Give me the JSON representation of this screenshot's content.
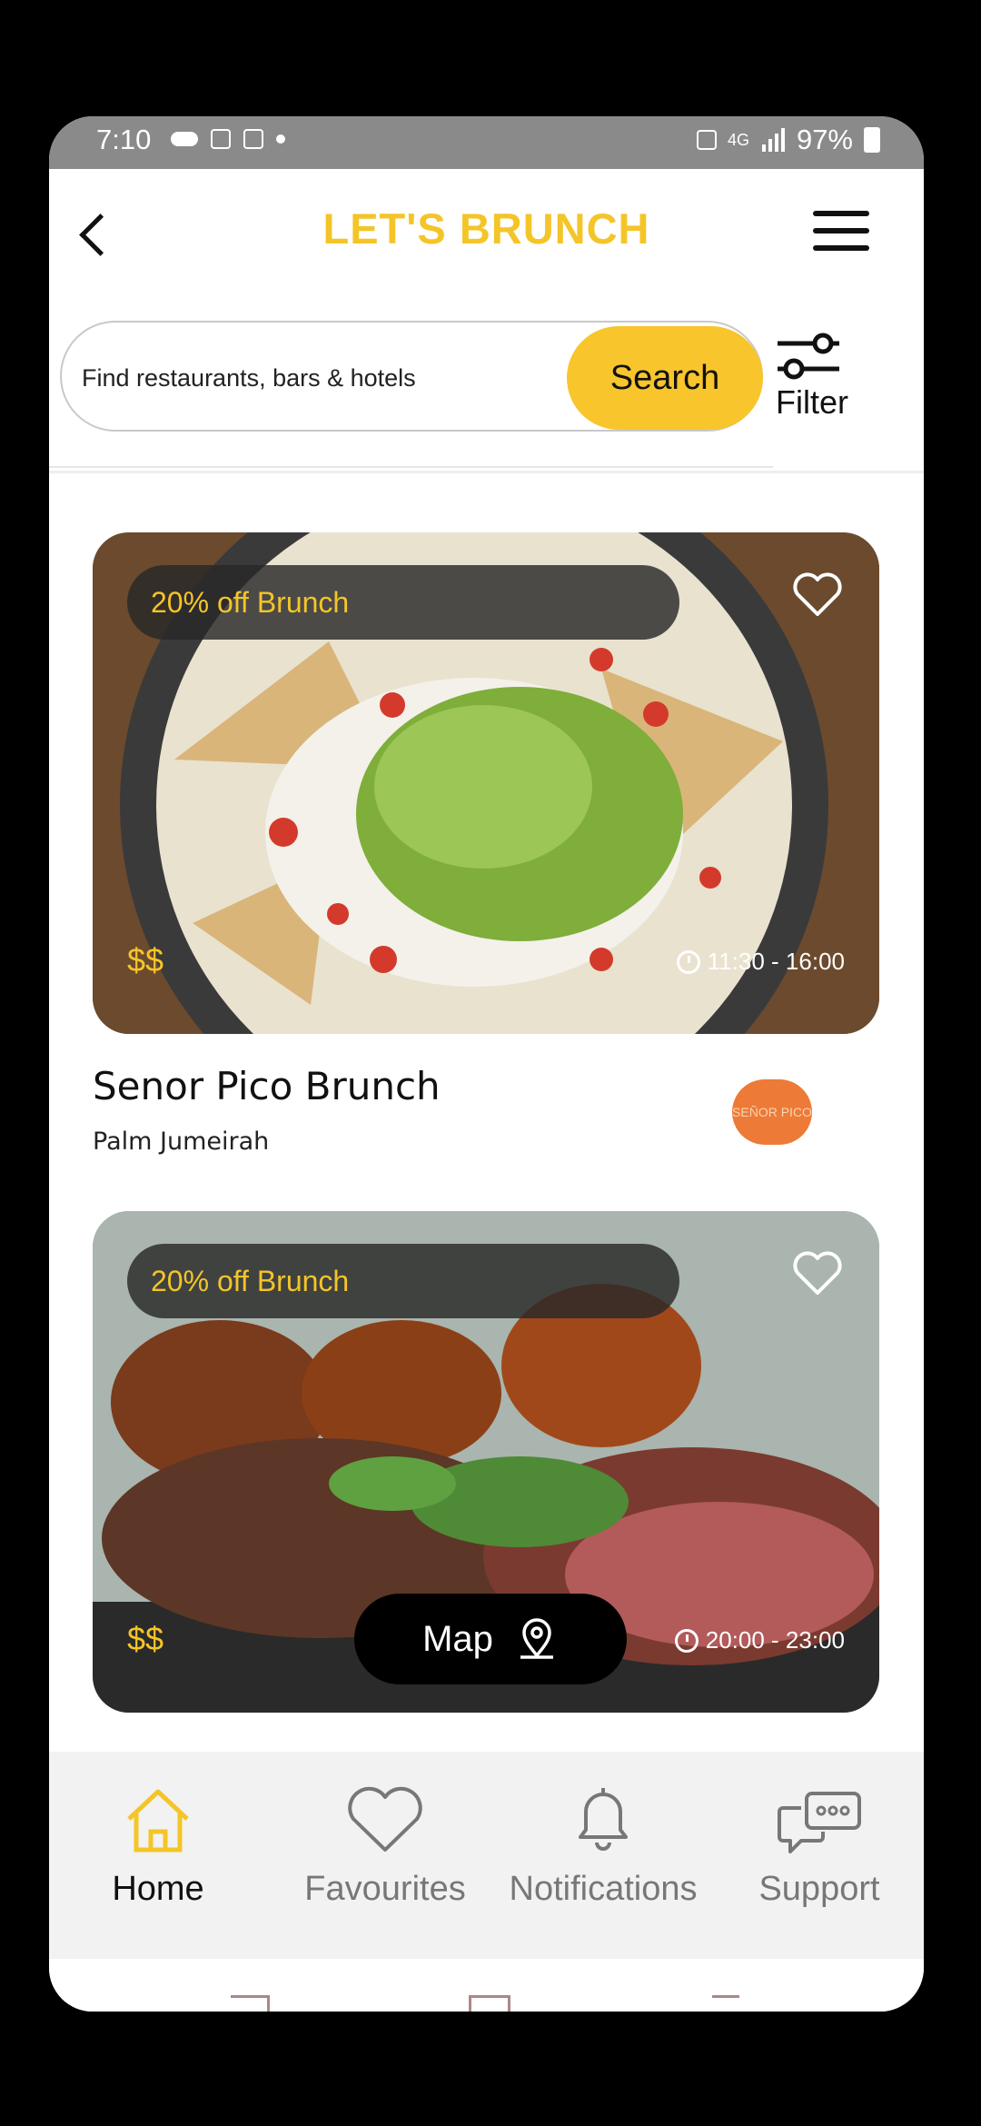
{
  "status_bar": {
    "time": "7:10",
    "network": "4G",
    "battery": "97%"
  },
  "header": {
    "title": "LET'S BRUNCH"
  },
  "search": {
    "placeholder": "Find restaurants, bars & hotels",
    "button_label": "Search",
    "filter_label": "Filter"
  },
  "listings": [
    {
      "promo": "20% off Brunch",
      "price": "$$",
      "hours": "11:30 - 16:00",
      "name": "Senor Pico Brunch",
      "location": "Palm Jumeirah",
      "logo_text": "SEÑOR PICO"
    },
    {
      "promo": "20% off Brunch",
      "price": "$$",
      "hours": "20:00 - 23:00"
    }
  ],
  "map_button": {
    "label": "Map"
  },
  "bottom_nav": [
    {
      "label": "Home",
      "active": true
    },
    {
      "label": "Favourites",
      "active": false
    },
    {
      "label": "Notifications",
      "active": false
    },
    {
      "label": "Support",
      "active": false
    }
  ],
  "colors": {
    "accent": "#f4c528",
    "search_button": "#f8c52c",
    "status_bar": "#8a8a8a"
  }
}
